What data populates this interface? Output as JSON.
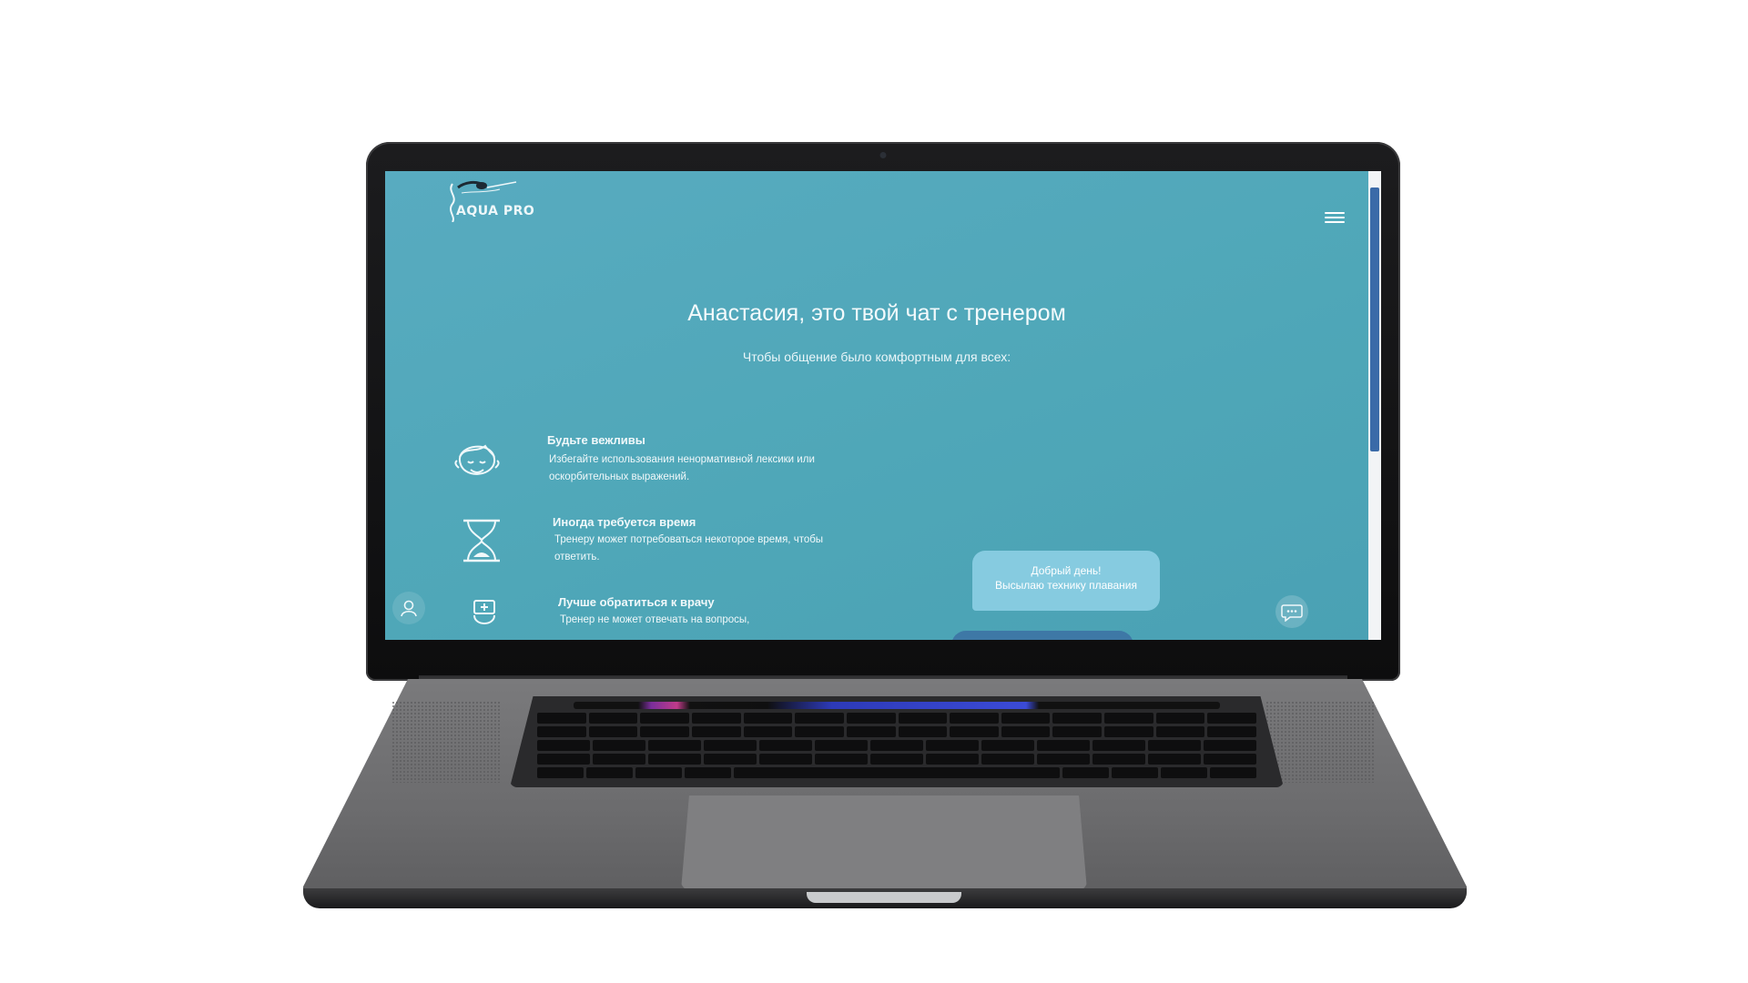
{
  "app": {
    "logo_text": "AQUA PRO"
  },
  "header": {
    "menu_icon": "hamburger-menu-icon"
  },
  "main": {
    "title": "Анастасия, это твой чат с тренером",
    "subtitle": "Чтобы общение было комфортным для всех:",
    "rules": [
      {
        "icon": "smiling-face-icon",
        "title": "Будьте вежливы",
        "text": "Избегайте использования ненормативной лексики или оскорбительных выражений."
      },
      {
        "icon": "hourglass-icon",
        "title": "Иногда требуется время",
        "text": "Тренеру может потребоваться некоторое время, чтобы ответить."
      },
      {
        "icon": "doctor-icon",
        "title": "Лучше обратиться к врачу",
        "text": "Тренер не может отвечать на вопросы,"
      }
    ]
  },
  "chat": {
    "bubble_line1": "Добрый день!",
    "bubble_line2": "Высылаю технику плавания"
  },
  "floating": {
    "profile_icon": "user-icon",
    "chat_icon": "chat-bubble-icon"
  },
  "colors": {
    "screen_bg": "#55a9bd",
    "bubble": "#86cbe0",
    "scroll_thumb": "#3a6aa8"
  }
}
